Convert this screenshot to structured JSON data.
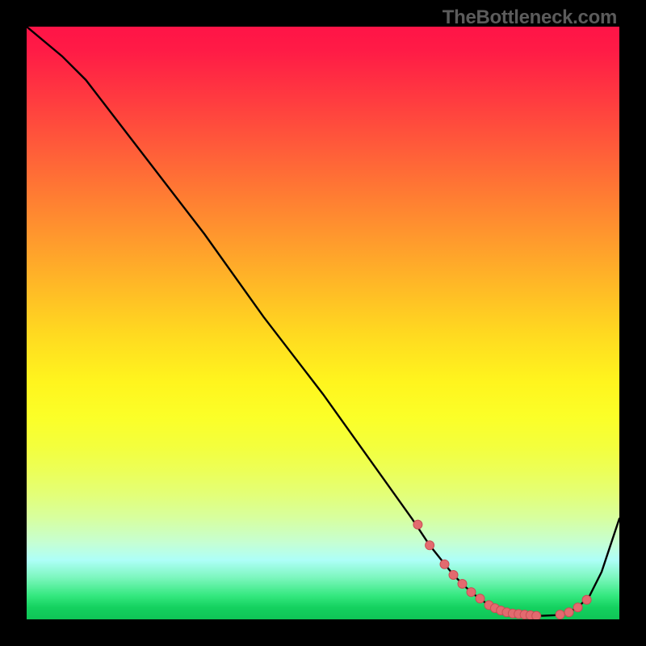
{
  "attribution": "TheBottleneck.com",
  "colors": {
    "frame": "#000000",
    "curve": "#000000",
    "marker_fill": "#e36a6f",
    "marker_stroke": "#c94f55",
    "gradient_top": "#ff1447",
    "gradient_bottom": "#0fc456"
  },
  "chart_data": {
    "type": "line",
    "title": "",
    "xlabel": "",
    "ylabel": "",
    "xlim": [
      0,
      100
    ],
    "ylim": [
      0,
      100
    ],
    "x": [
      0,
      6,
      10,
      20,
      30,
      40,
      50,
      60,
      65,
      68,
      70,
      72,
      74,
      76,
      78,
      80,
      81,
      82,
      84,
      85,
      87,
      89,
      91,
      93,
      95,
      97,
      100
    ],
    "values": [
      100,
      95,
      91,
      78,
      65,
      51,
      38,
      24,
      17,
      12.5,
      10,
      7.5,
      5.5,
      3.8,
      2.4,
      1.5,
      1.2,
      1.0,
      0.8,
      0.7,
      0.6,
      0.7,
      1.0,
      2.0,
      4.0,
      8.0,
      17
    ],
    "markers_x": [
      66,
      68,
      70.5,
      72,
      73.5,
      75,
      76.5,
      78,
      79,
      80,
      81,
      82,
      83,
      84,
      85,
      86,
      90,
      91.5,
      93,
      94.5
    ],
    "markers_y": [
      16,
      12.5,
      9.3,
      7.5,
      6.0,
      4.6,
      3.5,
      2.4,
      1.9,
      1.5,
      1.2,
      1.0,
      0.9,
      0.8,
      0.7,
      0.6,
      0.8,
      1.2,
      2.0,
      3.3
    ]
  }
}
